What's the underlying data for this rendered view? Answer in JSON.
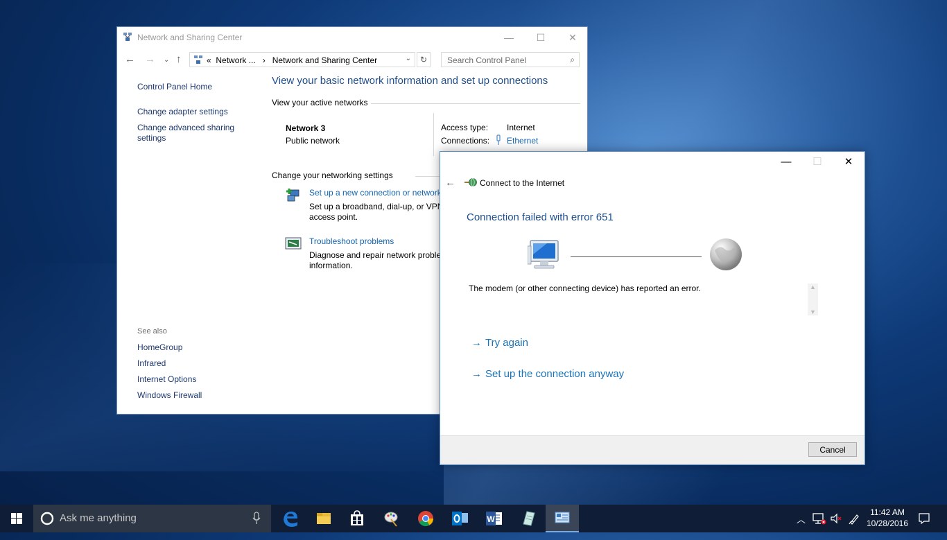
{
  "main_window": {
    "title": "Network and Sharing Center",
    "address": {
      "prefix": "«",
      "crumb1": "Network ...",
      "sep": "›",
      "crumb2": "Network and Sharing Center"
    },
    "search_placeholder": "Search Control Panel",
    "sidebar": {
      "home": "Control Panel Home",
      "adapter": "Change adapter settings",
      "sharing_line1": "Change advanced sharing",
      "sharing_line2": "settings",
      "see_also": "See also",
      "see_also_items": [
        "HomeGroup",
        "Infrared",
        "Internet Options",
        "Windows Firewall"
      ]
    },
    "heading": "View your basic network information and set up connections",
    "active_networks_label": "View your active networks",
    "network": {
      "name": "Network  3",
      "type": "Public network"
    },
    "access_type_label": "Access type:",
    "access_type_value": "Internet",
    "connections_label": "Connections:",
    "connections_value": "Ethernet",
    "change_settings_label": "Change your networking settings",
    "setup": {
      "link": "Set up a new connection or network",
      "desc1": "Set up a broadband, dial-up, or VPN",
      "desc2": "access point."
    },
    "troubleshoot": {
      "link": "Troubleshoot problems",
      "desc1": "Diagnose and repair network proble",
      "desc2": "information."
    }
  },
  "dialog": {
    "title": "Connect to the Internet",
    "error_heading": "Connection failed with error 651",
    "message": "The modem (or other connecting device) has reported an error.",
    "try_again": "Try again",
    "setup_anyway": "Set up the connection anyway",
    "cancel": "Cancel"
  },
  "taskbar": {
    "search_placeholder": "Ask me anything",
    "time": "11:42 AM",
    "date": "10/28/2016"
  },
  "colors": {
    "accent": "#1a73b8",
    "link": "#1565b0",
    "heading": "#1e4e8c",
    "taskbar": "#0f1e36"
  }
}
